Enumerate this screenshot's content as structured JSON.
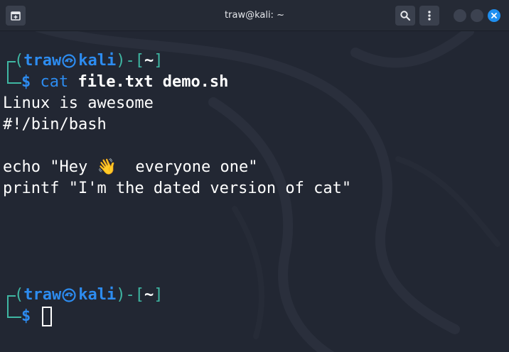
{
  "window": {
    "title": "traw@kali: ~"
  },
  "titlebar": {
    "new_tab_icon": "new-tab-icon",
    "search_icon": "search-icon",
    "menu_icon": "kebab-menu-icon",
    "close_color": "#1f8ff0"
  },
  "prompt1": {
    "open": "(",
    "user": "traw",
    "host": "kali",
    "close_dash": ")-[",
    "path": "~",
    "end": "]",
    "dollar": "$",
    "command": "cat",
    "args": "file.txt demo.sh"
  },
  "output": {
    "line1": "Linux is awesome",
    "line2": "#!/bin/bash",
    "line3": "",
    "line4": "echo \"Hey 👋  everyone one\"",
    "line5": "printf \"I'm the dated version of cat\""
  },
  "prompt2": {
    "open": "(",
    "user": "traw",
    "host": "kali",
    "close_dash": ")-[",
    "path": "~",
    "end": "]",
    "dollar": "$"
  },
  "colors": {
    "prompt_bracket": "#3fb7a3",
    "prompt_user": "#2d8cf0",
    "terminal_bg": "#222733",
    "text": "#ffffff"
  }
}
